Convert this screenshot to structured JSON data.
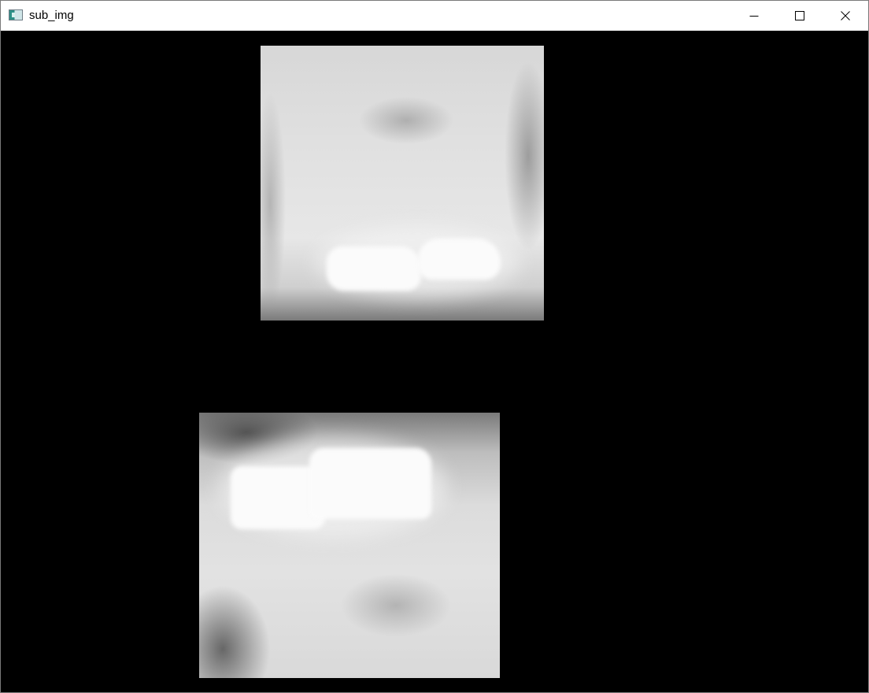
{
  "window": {
    "title": "sub_img",
    "app_icon": "opencv-window-icon",
    "controls": [
      "minimize-icon",
      "maximize-icon",
      "close-icon"
    ]
  },
  "content": {
    "background_color": "#000000",
    "images": [
      {
        "name": "dental-xray-upper"
      },
      {
        "name": "dental-xray-lower"
      }
    ]
  }
}
